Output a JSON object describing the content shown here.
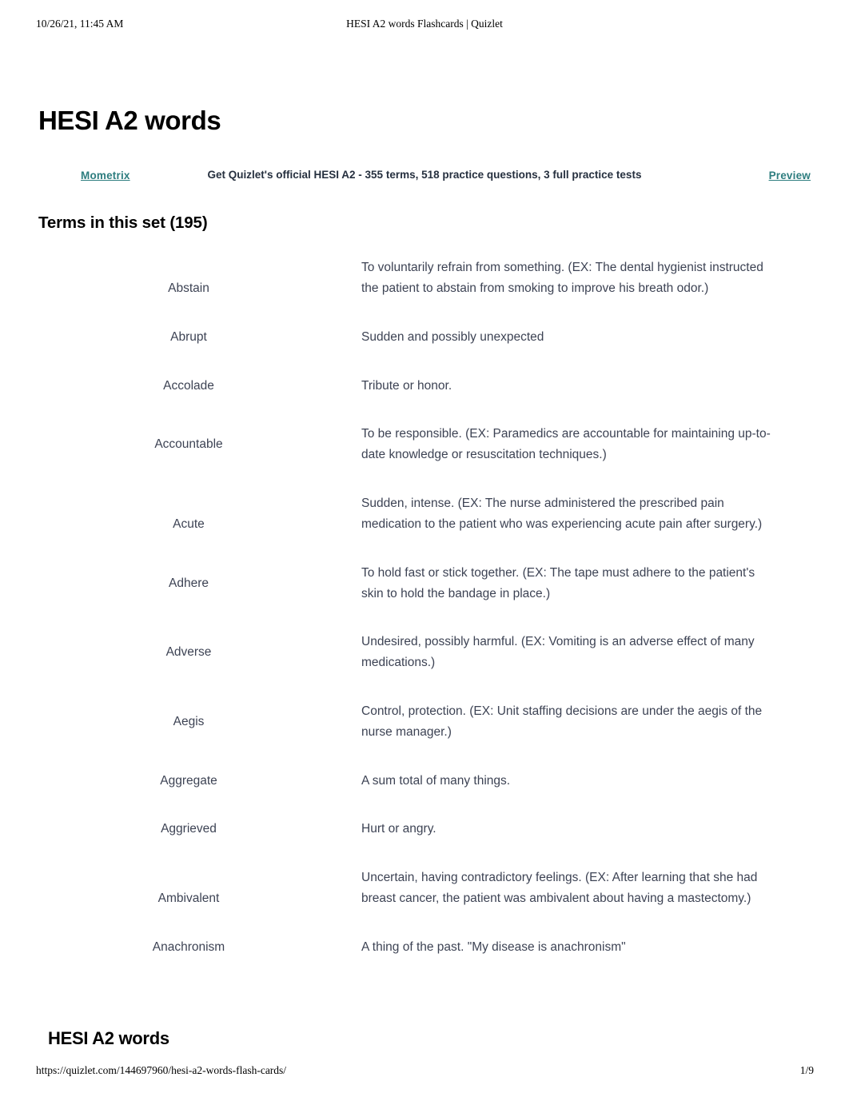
{
  "print_header": {
    "timestamp": "10/26/21, 11:45 AM",
    "document_title": "HESI A2 words Flashcards | Quizlet"
  },
  "print_footer": {
    "url": "https://quizlet.com/144697960/hesi-a2-words-flash-cards/",
    "page_number": "1/9"
  },
  "set": {
    "title": "HESI A2 words",
    "terms_heading": "Terms in this set (195)",
    "repeated_title": "HESI A2 words"
  },
  "promo": {
    "brand": "Mometrix",
    "text": "Get Quizlet's official HESI A2 - 355 terms, 518 practice questions, 3 full practice tests",
    "cta": "Preview",
    "brand_color": "#2d7d7f",
    "cta_color": "#2d7d7f",
    "text_color": "#26303f"
  },
  "colors": {
    "body_text": "#3d4354",
    "heading_text": "#000000",
    "background": "#ffffff",
    "accent_teal": "#2d7d7f"
  },
  "terms": [
    {
      "word": "Abstain",
      "definition": "To voluntarily refrain from something. (EX: The dental hygienist instructed the patient to abstain from smoking to improve his breath odor.)",
      "lines": 3
    },
    {
      "word": "Abrupt",
      "definition": "Sudden and possibly unexpected",
      "lines": 1
    },
    {
      "word": "Accolade",
      "definition": "Tribute or honor.",
      "lines": 1
    },
    {
      "word": "Accountable",
      "definition": "To be responsible. (EX: Paramedics are accountable for maintaining up-to-date knowledge or resuscitation techniques.)",
      "lines": 2
    },
    {
      "word": "Acute",
      "definition": "Sudden, intense. (EX: The nurse administered the prescribed pain medication to the patient who was experiencing acute pain after surgery.)",
      "lines": 3
    },
    {
      "word": "Adhere",
      "definition": "To hold fast or stick together. (EX: The tape must adhere to the patient's skin to hold the bandage in place.)",
      "lines": 2
    },
    {
      "word": "Adverse",
      "definition": "Undesired, possibly harmful. (EX: Vomiting is an adverse effect of many medications.)",
      "lines": 2
    },
    {
      "word": "Aegis",
      "definition": "Control, protection. (EX: Unit staffing decisions are under the aegis of the nurse manager.)",
      "lines": 2
    },
    {
      "word": "Aggregate",
      "definition": "A sum total of many things.",
      "lines": 1
    },
    {
      "word": "Aggrieved",
      "definition": "Hurt or angry.",
      "lines": 1
    },
    {
      "word": "Ambivalent",
      "definition": "Uncertain, having contradictory feelings. (EX: After learning that she had breast cancer, the patient was ambivalent about having a mastectomy.)",
      "lines": 3
    },
    {
      "word": "Anachronism",
      "definition": "A thing of the past. \"My disease is anachronism\"",
      "lines": 1
    }
  ]
}
